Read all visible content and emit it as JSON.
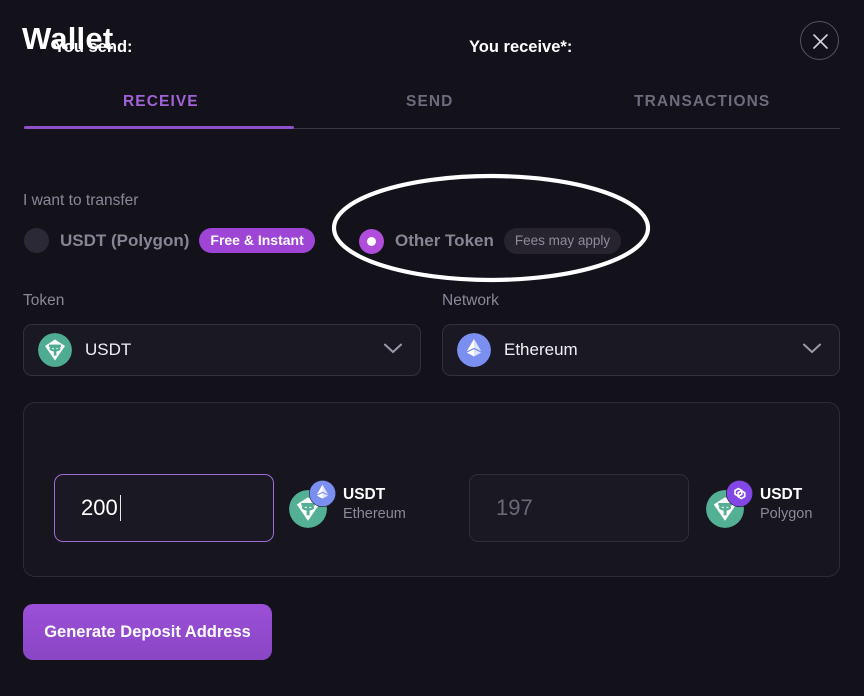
{
  "window": {
    "title": "Wallet",
    "close_icon": "close-icon"
  },
  "tabs": [
    {
      "label": "RECEIVE",
      "active": true
    },
    {
      "label": "SEND",
      "active": false
    },
    {
      "label": "TRANSACTIONS",
      "active": false
    }
  ],
  "transfer": {
    "label": "I want to transfer",
    "options": [
      {
        "label": "USDT (Polygon)",
        "chip": "Free & Instant",
        "selected": false
      },
      {
        "label": "Other Token",
        "chip": "Fees may apply",
        "selected": true
      }
    ]
  },
  "token_select": {
    "label": "Token",
    "value": "USDT",
    "icon": "usdt-coin-icon",
    "chevron": "chevron-down-icon"
  },
  "network_select": {
    "label": "Network",
    "value": "Ethereum",
    "icon": "ethereum-coin-icon",
    "chevron": "chevron-down-icon"
  },
  "exchange": {
    "send": {
      "heading": "You send:",
      "amount": "200",
      "symbol": "USDT",
      "network": "Ethereum",
      "base_icon": "usdt-coin-icon",
      "badge_icon": "ethereum-coin-icon"
    },
    "receive": {
      "heading": "You receive*:",
      "amount": "197",
      "symbol": "USDT",
      "network": "Polygon",
      "base_icon": "usdt-coin-icon",
      "badge_icon": "polygon-coin-icon"
    }
  },
  "primary_action": {
    "label": "Generate Deposit Address"
  },
  "annotation": {
    "shape": "ellipse-highlight",
    "color": "#ffffff"
  },
  "colors": {
    "background": "#131119",
    "accent_purple": "#9b4fd8",
    "tab_active": "#a163d8",
    "usdt_green": "#50af95",
    "ethereum_blue": "#7b8ff0",
    "polygon_purple": "#8247e5",
    "muted_text": "#8b8899"
  }
}
